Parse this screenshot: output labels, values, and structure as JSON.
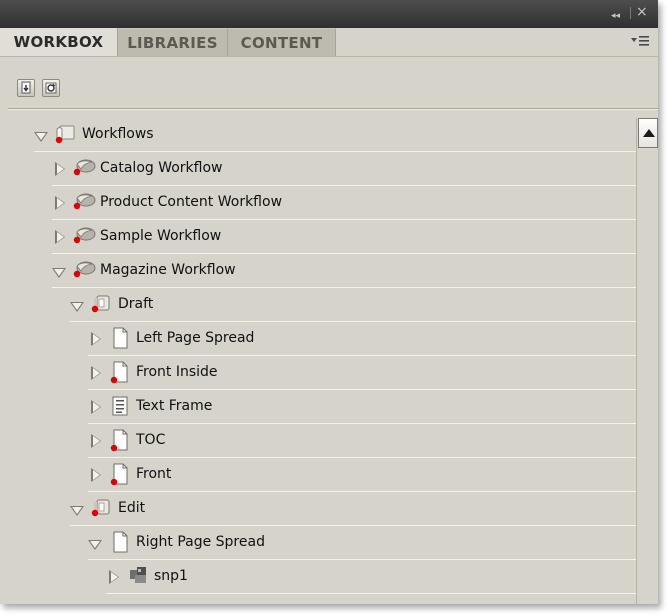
{
  "titlebar": {
    "collapse_glyph": "◂◂",
    "close_glyph": "×"
  },
  "tabs": [
    {
      "label": "WORKBOX",
      "active": true
    },
    {
      "label": "LIBRARIES",
      "active": false
    },
    {
      "label": "CONTENT",
      "active": false
    }
  ],
  "tab_menu_icon": "panel-menu-icon",
  "toolbar": {
    "buttons": [
      {
        "icon": "checkin-icon"
      },
      {
        "icon": "refresh-icon"
      }
    ]
  },
  "tree": {
    "items": [
      {
        "label": "Workflows",
        "level": 0,
        "state": "expanded",
        "icon": "workflows-folder-icon"
      },
      {
        "label": "Catalog Workflow",
        "level": 1,
        "state": "collapsed",
        "icon": "workflow-icon"
      },
      {
        "label": "Product Content Workflow",
        "level": 1,
        "state": "collapsed",
        "icon": "workflow-icon"
      },
      {
        "label": "Sample Workflow",
        "level": 1,
        "state": "collapsed",
        "icon": "workflow-icon"
      },
      {
        "label": "Magazine Workflow",
        "level": 1,
        "state": "expanded",
        "icon": "workflow-icon"
      },
      {
        "label": "Draft",
        "level": 2,
        "state": "expanded",
        "icon": "stage-icon"
      },
      {
        "label": "Left Page Spread",
        "level": 3,
        "state": "collapsed",
        "icon": "page-icon"
      },
      {
        "label": "Front Inside",
        "level": 3,
        "state": "collapsed",
        "icon": "page-icon"
      },
      {
        "label": "Text Frame",
        "level": 3,
        "state": "collapsed",
        "icon": "text-frame-icon"
      },
      {
        "label": "TOC",
        "level": 3,
        "state": "collapsed",
        "icon": "page-icon"
      },
      {
        "label": "Front",
        "level": 3,
        "state": "collapsed",
        "icon": "page-icon"
      },
      {
        "label": "Edit",
        "level": 2,
        "state": "expanded",
        "icon": "stage-icon"
      },
      {
        "label": "Right Page Spread",
        "level": 3,
        "state": "expanded",
        "icon": "page-icon"
      },
      {
        "label": "snp1",
        "level": 4,
        "state": "collapsed",
        "icon": "snippet-icon"
      }
    ]
  },
  "colors": {
    "panel_bg": "#d6d3cb",
    "titlebar_bg": "#3c3c3c",
    "active_tab_bg": "#e1ded7",
    "inactive_tab_bg": "#bdbab0",
    "status_dot": "#e00000",
    "row_line": "#f4f2ec"
  }
}
